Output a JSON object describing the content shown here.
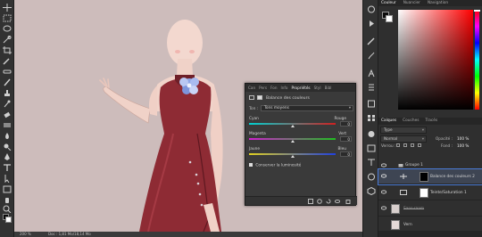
{
  "colors": {
    "accent": "#4a7bd6",
    "canvas_bg": "#cdbcbb",
    "dress": "#8e2b34",
    "skin": "#f2d8cf"
  },
  "toolbar": {
    "tools": [
      "move-icon",
      "marquee-icon",
      "lasso-icon",
      "quick-select-icon",
      "crop-icon",
      "eyedropper-icon",
      "healing-icon",
      "brush-icon",
      "stamp-icon",
      "history-brush-icon",
      "eraser-icon",
      "gradient-icon",
      "blur-icon",
      "dodge-icon",
      "pen-icon",
      "type-icon",
      "path-select-icon",
      "shape-icon",
      "hand-icon",
      "zoom-icon",
      "more-icon"
    ]
  },
  "status": {
    "zoom": "200 %",
    "doc": "Doc : 1,81 Mo/18,14 Mo"
  },
  "right_dock": {
    "color_tabs": [
      "Couleur",
      "Nuancier",
      "Navigation"
    ],
    "layer_tabs": [
      "Calques",
      "Couches",
      "Tracés"
    ],
    "filter_type": "Type",
    "blend_mode": "Normal",
    "opacity_label": "Opacité :",
    "opacity_value": "100 %",
    "lock_label": "Verrou :",
    "fill_label": "Fond :",
    "fill_value": "100 %",
    "group_name": "Groupe 1",
    "layers": [
      {
        "name": "Balance des couleurs 2",
        "selected": true
      },
      {
        "name": "Teinte/Saturation 1",
        "selected": false
      },
      {
        "name": "Sans-raam",
        "selected": false
      },
      {
        "name": "Vern",
        "selected": false
      }
    ]
  },
  "properties": {
    "tabs": [
      "Can",
      "Pers",
      "Fon",
      "Info",
      "Propriétés",
      "Styl",
      "Bibl"
    ],
    "active_tab": "Propriétés",
    "title": "Balance des couleurs",
    "tone_label": "Ton :",
    "tone_value": "Tons moyens",
    "sliders": [
      {
        "left": "Cyan",
        "right": "Rouge",
        "value": "0",
        "gradient": "linear-gradient(to right,#00d0d0,#d02020)"
      },
      {
        "left": "Magenta",
        "right": "Vert",
        "value": "0",
        "gradient": "linear-gradient(to right,#d020d0,#20c020)"
      },
      {
        "left": "Jaune",
        "right": "Bleu",
        "value": "0",
        "gradient": "linear-gradient(to right,#e0d020,#2040e0)"
      }
    ],
    "preserve_label": "Conserver la luminosité"
  }
}
